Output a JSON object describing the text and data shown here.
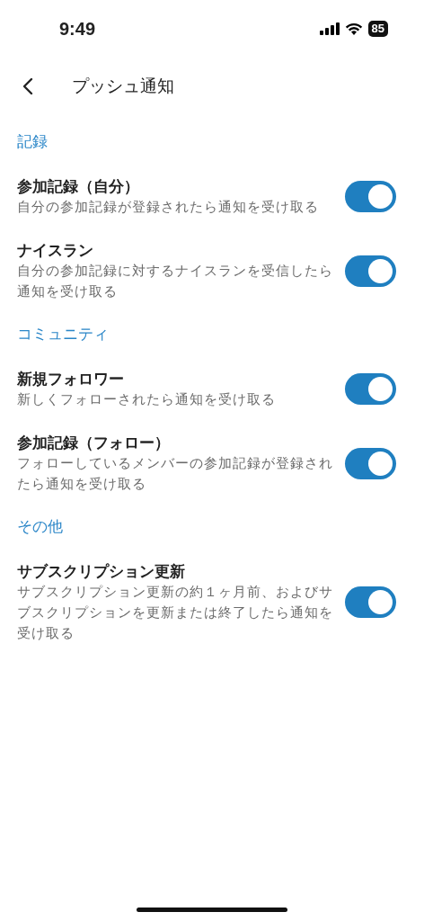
{
  "status_bar": {
    "time": "9:49",
    "battery": "85"
  },
  "header": {
    "title": "プッシュ通知"
  },
  "sections": [
    {
      "title": "記録",
      "items": [
        {
          "title": "参加記録（自分）",
          "description": "自分の参加記録が登録されたら通知を受け取る",
          "on": true
        },
        {
          "title": "ナイスラン",
          "description": "自分の参加記録に対するナイスランを受信したら通知を受け取る",
          "on": true
        }
      ]
    },
    {
      "title": "コミュニティ",
      "items": [
        {
          "title": "新規フォロワー",
          "description": "新しくフォローされたら通知を受け取る",
          "on": true
        },
        {
          "title": "参加記録（フォロー）",
          "description": "フォローしているメンバーの参加記録が登録されたら通知を受け取る",
          "on": true
        }
      ]
    },
    {
      "title": "その他",
      "items": [
        {
          "title": "サブスクリプション更新",
          "description": "サブスクリプション更新の約１ヶ月前、およびサブスクリプションを更新または終了したら通知を受け取る",
          "on": true
        }
      ]
    }
  ]
}
